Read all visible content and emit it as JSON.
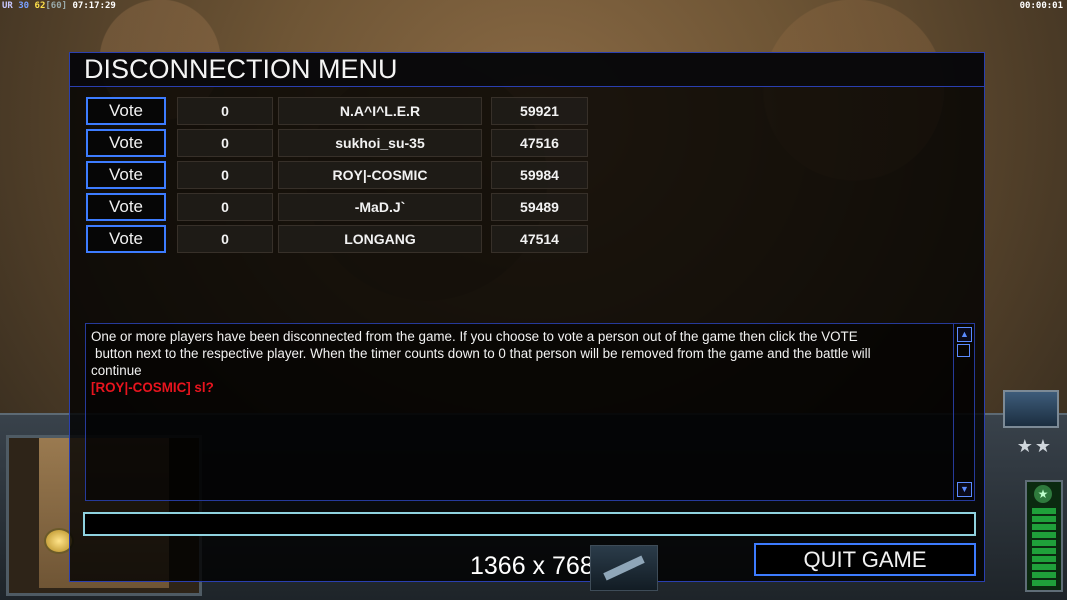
{
  "hud": {
    "ur": "UR",
    "a": "30",
    "b": "62",
    "c": "[60]",
    "clock": "07:17:29",
    "timer": "00:00:01"
  },
  "dialog": {
    "title": "DISCONNECTION MENU",
    "players": [
      {
        "vote_label": "Vote",
        "timer": "0",
        "name": "N.A^I^L.E.R",
        "id": "59921"
      },
      {
        "vote_label": "Vote",
        "timer": "0",
        "name": "sukhoi_su-35",
        "id": "47516"
      },
      {
        "vote_label": "Vote",
        "timer": "0",
        "name": "ROY|-COSMIC",
        "id": "59984"
      },
      {
        "vote_label": "Vote",
        "timer": "0",
        "name": "-MaD.J`",
        "id": "59489"
      },
      {
        "vote_label": "Vote",
        "timer": "0",
        "name": "LONGANG",
        "id": "47514"
      }
    ],
    "message_line1": "One or more players have been disconnected from the game. If you choose to vote a person out of the game then click the VOTE",
    "message_line2": "button next to the respective player. When the timer counts down to 0 that person will be removed from the game and the battle will",
    "message_line3": "continue",
    "chat_line": "[ROY|-COSMIC] sl?",
    "chat_input_value": "",
    "quit_label": "QUIT GAME"
  },
  "resolution_label": "1366 x 768",
  "colors": {
    "accent_blue": "#3d7cff",
    "chat_red": "#e8141e",
    "input_border": "#8fd2df"
  }
}
